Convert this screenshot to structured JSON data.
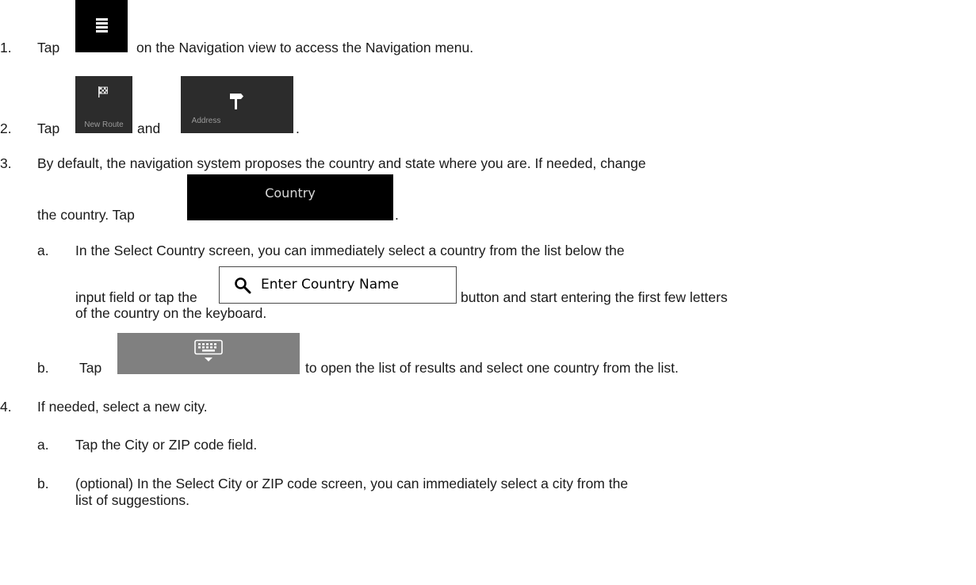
{
  "steps": [
    {
      "number": "1.",
      "tap_word": "Tap",
      "icon": "hamburger-menu-icon",
      "text": "on the Navigation view to access the Navigation menu."
    },
    {
      "number": "2.",
      "tap_word": "Tap",
      "tile1_label": "New Route",
      "tile1_icon": "checkered-flag-icon",
      "and_word": "and",
      "tile2_label": "Address",
      "tile2_icon": "signpost-icon",
      "end": "."
    },
    {
      "number": "3.",
      "text_line1": "By default, the navigation system proposes the country and state where you are. If needed, change",
      "text_line2": "the country. Tap",
      "country_button_label": "Country",
      "end": ".",
      "substeps": [
        {
          "letter": "a.",
          "text_line1": "In the Select Country screen, you can immediately select a country from the list below the",
          "text_line2_a": "input field or tap the",
          "search_button_label": "Enter Country Name",
          "search_icon": "search-icon",
          "text_line2_b": "button and start entering the first few letters",
          "text_line3": "of the country on the keyboard."
        },
        {
          "letter": "b.",
          "tap_word": "Tap",
          "keyboard_icon": "keyboard-hide-icon",
          "text": "to open the list of results and select one country from the list."
        }
      ]
    },
    {
      "number": "4.",
      "text": "If needed, select a new city.",
      "substeps": [
        {
          "letter": "a.",
          "text": "Tap the City or ZIP code field."
        },
        {
          "letter": "b.",
          "text_line1": "(optional) In the Select City or ZIP code screen, you can immediately select a city from the",
          "text_line2": "list of suggestions."
        }
      ]
    }
  ]
}
